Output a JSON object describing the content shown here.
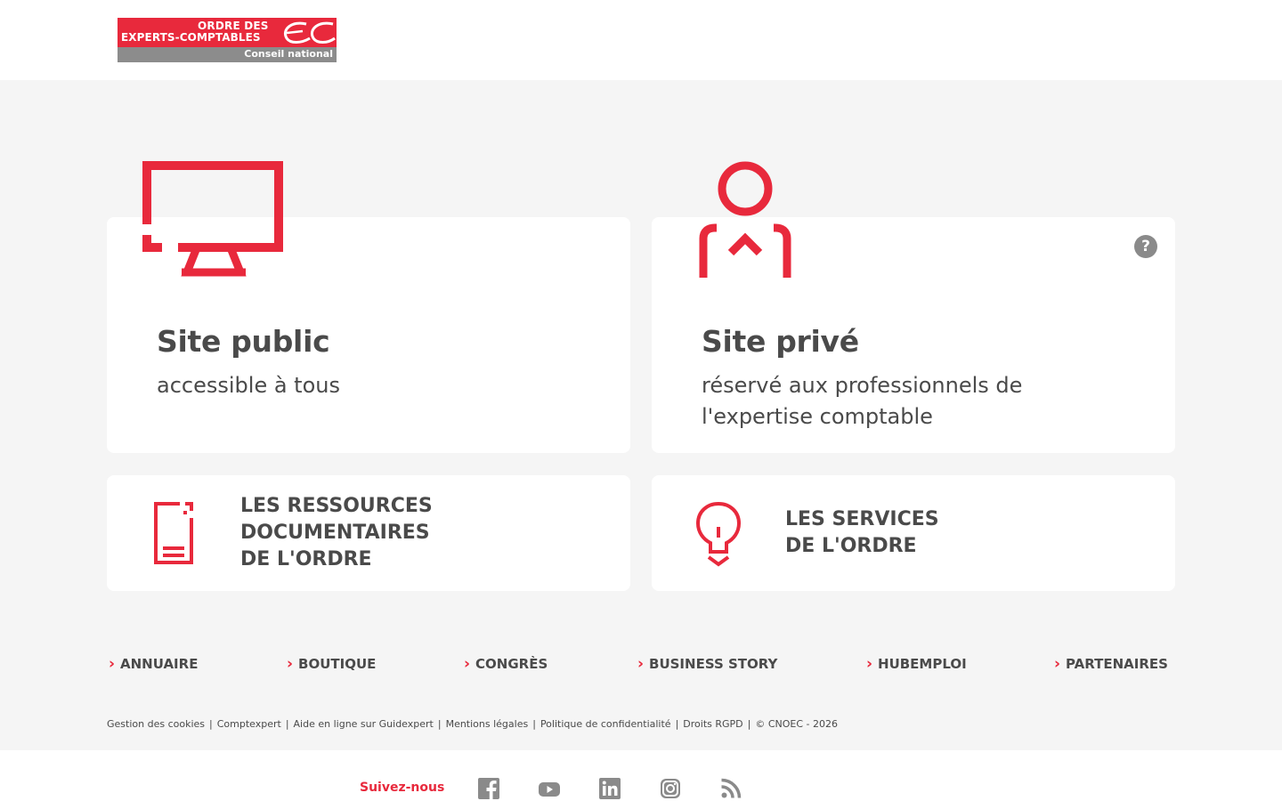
{
  "header": {
    "logo": {
      "line1": "ORDRE DES",
      "line2": "EXPERTS-COMPTABLES",
      "line3": "Conseil national"
    }
  },
  "cards": {
    "public": {
      "title": "Site public",
      "subtitle": "accessible à tous",
      "icon": "monitor-icon"
    },
    "private": {
      "title": "Site privé",
      "subtitle": "réservé aux professionnels de l'expertise comptable",
      "icon": "person-icon",
      "help": "?"
    },
    "ressources": {
      "line1": "LES RESSOURCES",
      "line2": "DOCUMENTAIRES",
      "line3": "DE L'ORDRE",
      "icon": "document-icon"
    },
    "services": {
      "line1": "LES SERVICES",
      "line2": "DE L'ORDRE",
      "icon": "lightbulb-icon"
    }
  },
  "quick_links": [
    {
      "label": "ANNUAIRE"
    },
    {
      "label": "BOUTIQUE"
    },
    {
      "label": "CONGRÈS"
    },
    {
      "label": "BUSINESS STORY"
    },
    {
      "label": "HUBEMPLOI"
    },
    {
      "label": "PARTENAIRES"
    }
  ],
  "legal_links": [
    "Gestion des cookies",
    "Comptexpert",
    "Aide en ligne sur Guidexpert",
    "Mentions légales",
    "Politique de confidentialité",
    "Droits RGPD",
    "© CNOEC - 2026"
  ],
  "footer": {
    "follow_label": "Suivez-nous",
    "social": [
      "facebook-icon",
      "youtube-icon",
      "linkedin-icon",
      "instagram-icon",
      "rss-icon"
    ]
  },
  "colors": {
    "accent": "#e8293c",
    "text": "#4a4a4a",
    "background": "#f5f5f5",
    "logo_gray": "#8c8c8c"
  }
}
